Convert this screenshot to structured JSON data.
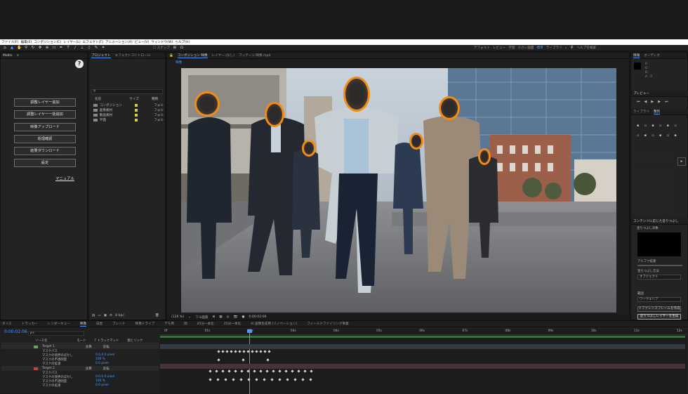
{
  "menu": [
    "ファイル(F)",
    "編集(E)",
    "コンポジション(C)",
    "レイヤー(L)",
    "エフェクト(T)",
    "アニメーション(A)",
    "ビュー(V)",
    "ウィンドウ(W)",
    "ヘルプ(H)"
  ],
  "toolbar": {
    "snap_label": "スナップ",
    "workspaces": [
      "デフォルト",
      "レビュー",
      "学習",
      "小さい画面",
      "標準",
      "ライブラリ"
    ],
    "active_workspace": "標準",
    "search_placeholder": "ヘルプを検索"
  },
  "left_panel": {
    "title": "Maltis",
    "buttons": [
      "調整レイヤー追加",
      "調整レイヤー一括追加",
      "映像アップロード",
      "処理確認",
      "結果ダウンロード",
      "設定"
    ],
    "manual_link": "マニュアル"
  },
  "project_panel": {
    "tabs": [
      "プロジェクト",
      "エフェクトコントロール"
    ],
    "columns": [
      "名前",
      "サイズ",
      "種類"
    ],
    "items": [
      {
        "name": "コンポジション",
        "type": "フォル"
      },
      {
        "name": "画像素材",
        "type": "フォル"
      },
      {
        "name": "動画素材",
        "type": "フォル"
      },
      {
        "name": "平面",
        "type": "フォル"
      }
    ],
    "bpc": "8 bpc"
  },
  "comp_panel": {
    "tabs": [
      "コンポジション 映像",
      "レイヤー (なし)",
      "フッテージ 映像.mp4"
    ],
    "breadcrumb": "映像",
    "zoom": "(126 %)",
    "quality": "フル画質",
    "timecode": "0:00:02:06"
  },
  "right_panel": {
    "info_tab": "情報",
    "audio_tab": "オーディオ",
    "preview_tab": "プレビュー",
    "library_tab": "ライブラリ",
    "align_tab": "整列",
    "content_aware_title": "コンテンツに応じた塗りつぶし",
    "fill_target": "塗りつぶし対象",
    "alpha_label": "アルファ拡張",
    "fill_method_label": "塗りつぶし方法",
    "fill_method_value": "オブジェクト",
    "range_label": "範囲",
    "range_value": "ワークエリア",
    "btn_create_reference": "リファレンスフレームを作成",
    "btn_generate_fill": "塗りつぶしレイヤーを生成"
  },
  "timeline": {
    "tabs": [
      "ボイス",
      "トラッカー",
      "レンダーキュー",
      "映像",
      "白昼",
      "ブレンド",
      "映像ドライブ",
      "デモ用",
      "顔",
      "45分一本化",
      "45分一本化",
      "AI 画像生成用 (リノベーション)",
      "フィールドファイリング事業"
    ],
    "active_tab": "映像",
    "timecode": "0:00:02:06",
    "search_placeholder": "ρ+",
    "layer_header": "ソース名",
    "mode_header": "モード",
    "track_header": "T トラックマット",
    "parent_header": "親とリンク",
    "ruler": [
      "0f",
      "01s",
      "02s",
      "03s",
      "04s",
      "05s",
      "06s",
      "07s",
      "08s",
      "09s",
      "10s",
      "11s",
      "12s"
    ],
    "layers": [
      {
        "name": "Target 1",
        "mode": "加算",
        "track": "反転",
        "props": [
          {
            "label": "マスクパス",
            "value": ""
          },
          {
            "label": "マスクの境界のぼかし",
            "value": "0.0,0.0 pixel"
          },
          {
            "label": "マスクの不透明度",
            "value": "100 %"
          },
          {
            "label": "マスクの拡張",
            "value": "0.0 pixel"
          }
        ]
      },
      {
        "name": "Target 2",
        "mode": "加算",
        "track": "反転",
        "props": [
          {
            "label": "マスクパス",
            "value": ""
          },
          {
            "label": "マスクの境界のぼかし",
            "value": "0.0,0.0 pixel"
          },
          {
            "label": "マスクの不透明度",
            "value": "100 %"
          },
          {
            "label": "マスクの拡張",
            "value": "0.0 pixel"
          }
        ]
      }
    ]
  },
  "colors": {
    "accent": "#4a9bff",
    "mask": "#f08c14",
    "panel": "#232323"
  }
}
